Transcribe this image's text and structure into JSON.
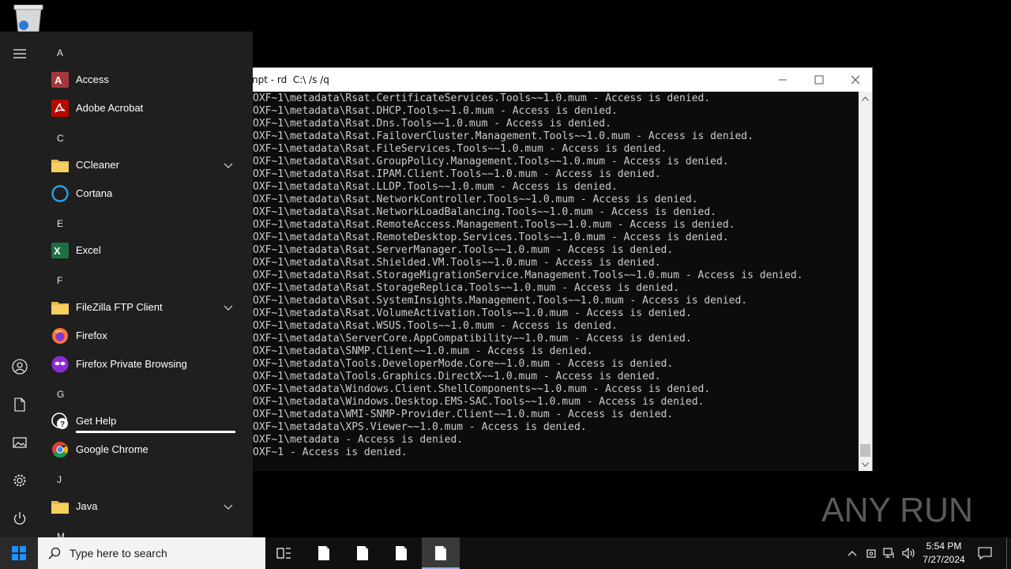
{
  "console": {
    "title": "npt - rd  C:\\ /s /q",
    "lines": [
      "OXF~1\\metadata\\Rsat.CertificateServices.Tools~~1.0.mum - Access is denied.",
      "OXF~1\\metadata\\Rsat.DHCP.Tools~~1.0.mum - Access is denied.",
      "OXF~1\\metadata\\Rsat.Dns.Tools~~1.0.mum - Access is denied.",
      "OXF~1\\metadata\\Rsat.FailoverCluster.Management.Tools~~1.0.mum - Access is denied.",
      "OXF~1\\metadata\\Rsat.FileServices.Tools~~1.0.mum - Access is denied.",
      "OXF~1\\metadata\\Rsat.GroupPolicy.Management.Tools~~1.0.mum - Access is denied.",
      "OXF~1\\metadata\\Rsat.IPAM.Client.Tools~~1.0.mum - Access is denied.",
      "OXF~1\\metadata\\Rsat.LLDP.Tools~~1.0.mum - Access is denied.",
      "OXF~1\\metadata\\Rsat.NetworkController.Tools~~1.0.mum - Access is denied.",
      "OXF~1\\metadata\\Rsat.NetworkLoadBalancing.Tools~~1.0.mum - Access is denied.",
      "OXF~1\\metadata\\Rsat.RemoteAccess.Management.Tools~~1.0.mum - Access is denied.",
      "OXF~1\\metadata\\Rsat.RemoteDesktop.Services.Tools~~1.0.mum - Access is denied.",
      "OXF~1\\metadata\\Rsat.ServerManager.Tools~~1.0.mum - Access is denied.",
      "OXF~1\\metadata\\Rsat.Shielded.VM.Tools~~1.0.mum - Access is denied.",
      "OXF~1\\metadata\\Rsat.StorageMigrationService.Management.Tools~~1.0.mum - Access is denied.",
      "OXF~1\\metadata\\Rsat.StorageReplica.Tools~~1.0.mum - Access is denied.",
      "OXF~1\\metadata\\Rsat.SystemInsights.Management.Tools~~1.0.mum - Access is denied.",
      "OXF~1\\metadata\\Rsat.VolumeActivation.Tools~~1.0.mum - Access is denied.",
      "OXF~1\\metadata\\Rsat.WSUS.Tools~~1.0.mum - Access is denied.",
      "OXF~1\\metadata\\ServerCore.AppCompatibility~~1.0.mum - Access is denied.",
      "OXF~1\\metadata\\SNMP.Client~~1.0.mum - Access is denied.",
      "OXF~1\\metadata\\Tools.DeveloperMode.Core~~1.0.mum - Access is denied.",
      "OXF~1\\metadata\\Tools.Graphics.DirectX~~1.0.mum - Access is denied.",
      "OXF~1\\metadata\\Windows.Client.ShellComponents~~1.0.mum - Access is denied.",
      "OXF~1\\metadata\\Windows.Desktop.EMS-SAC.Tools~~1.0.mum - Access is denied.",
      "OXF~1\\metadata\\WMI-SNMP-Provider.Client~~1.0.mum - Access is denied.",
      "OXF~1\\metadata\\XPS.Viewer~~1.0.mum - Access is denied.",
      "OXF~1\\metadata - Access is denied.",
      "OXF~1 - Access is denied."
    ]
  },
  "start_menu": {
    "letters": {
      "a": "A",
      "c": "C",
      "e": "E",
      "f": "F",
      "g": "G",
      "j": "J",
      "m": "M"
    },
    "apps": {
      "access": "Access",
      "acrobat": "Adobe Acrobat",
      "ccleaner": "CCleaner",
      "cortana": "Cortana",
      "excel": "Excel",
      "filezilla": "FileZilla FTP Client",
      "firefox": "Firefox",
      "firefox_private": "Firefox Private Browsing",
      "get_help": "Get Help",
      "chrome": "Google Chrome",
      "java": "Java"
    }
  },
  "taskbar": {
    "search_placeholder": "Type here to search",
    "time": "5:54 PM",
    "date": "7/27/2024"
  },
  "watermark": {
    "text": "ANY RUN"
  },
  "colors": {
    "console_bg": "#0c0c0c",
    "console_text": "#cccccc",
    "start_bg": "#1f1f1f",
    "taskbar_bg": "#101010"
  }
}
